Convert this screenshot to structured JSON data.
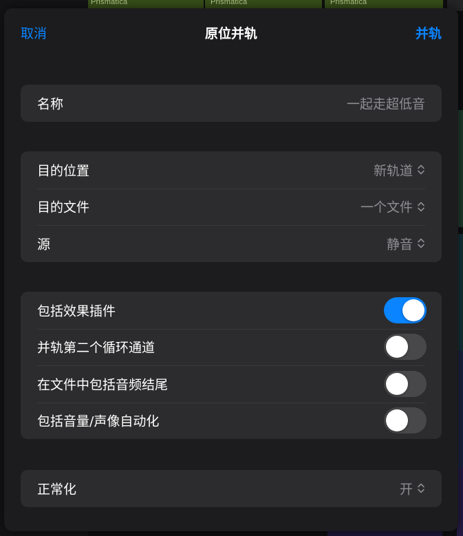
{
  "background": {
    "region_labels": [
      "Prismatica",
      "Prismatica",
      "Prismatica"
    ]
  },
  "nav": {
    "cancel_label": "取消",
    "title": "原位并轨",
    "confirm_label": "并轨"
  },
  "name_group": {
    "label": "名称",
    "value": "一起走超低音"
  },
  "destination_group": {
    "rows": [
      {
        "label": "目的位置",
        "value": "新轨道"
      },
      {
        "label": "目的文件",
        "value": "一个文件"
      },
      {
        "label": "源",
        "value": "静音"
      }
    ]
  },
  "options_group": {
    "rows": [
      {
        "label": "包括效果插件",
        "enabled": true
      },
      {
        "label": "并轨第二个循环通道",
        "enabled": false
      },
      {
        "label": "在文件中包括音频结尾",
        "enabled": false
      },
      {
        "label": "包括音量/声像自动化",
        "enabled": false
      }
    ]
  },
  "normalize_group": {
    "label": "正常化",
    "value": "开"
  },
  "colors": {
    "accent": "#0a84ff",
    "sheet_background": "#1c1c1e",
    "group_background": "#2c2c2e",
    "secondary_text": "#8e8e93"
  }
}
